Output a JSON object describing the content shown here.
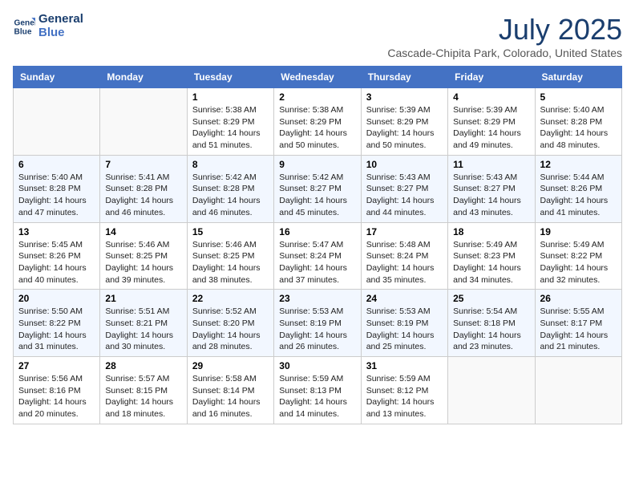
{
  "logo": {
    "line1": "General",
    "line2": "Blue"
  },
  "title": "July 2025",
  "location": "Cascade-Chipita Park, Colorado, United States",
  "days_of_week": [
    "Sunday",
    "Monday",
    "Tuesday",
    "Wednesday",
    "Thursday",
    "Friday",
    "Saturday"
  ],
  "weeks": [
    [
      {
        "day": "",
        "info": ""
      },
      {
        "day": "",
        "info": ""
      },
      {
        "day": "1",
        "info": "Sunrise: 5:38 AM\nSunset: 8:29 PM\nDaylight: 14 hours and 51 minutes."
      },
      {
        "day": "2",
        "info": "Sunrise: 5:38 AM\nSunset: 8:29 PM\nDaylight: 14 hours and 50 minutes."
      },
      {
        "day": "3",
        "info": "Sunrise: 5:39 AM\nSunset: 8:29 PM\nDaylight: 14 hours and 50 minutes."
      },
      {
        "day": "4",
        "info": "Sunrise: 5:39 AM\nSunset: 8:29 PM\nDaylight: 14 hours and 49 minutes."
      },
      {
        "day": "5",
        "info": "Sunrise: 5:40 AM\nSunset: 8:28 PM\nDaylight: 14 hours and 48 minutes."
      }
    ],
    [
      {
        "day": "6",
        "info": "Sunrise: 5:40 AM\nSunset: 8:28 PM\nDaylight: 14 hours and 47 minutes."
      },
      {
        "day": "7",
        "info": "Sunrise: 5:41 AM\nSunset: 8:28 PM\nDaylight: 14 hours and 46 minutes."
      },
      {
        "day": "8",
        "info": "Sunrise: 5:42 AM\nSunset: 8:28 PM\nDaylight: 14 hours and 46 minutes."
      },
      {
        "day": "9",
        "info": "Sunrise: 5:42 AM\nSunset: 8:27 PM\nDaylight: 14 hours and 45 minutes."
      },
      {
        "day": "10",
        "info": "Sunrise: 5:43 AM\nSunset: 8:27 PM\nDaylight: 14 hours and 44 minutes."
      },
      {
        "day": "11",
        "info": "Sunrise: 5:43 AM\nSunset: 8:27 PM\nDaylight: 14 hours and 43 minutes."
      },
      {
        "day": "12",
        "info": "Sunrise: 5:44 AM\nSunset: 8:26 PM\nDaylight: 14 hours and 41 minutes."
      }
    ],
    [
      {
        "day": "13",
        "info": "Sunrise: 5:45 AM\nSunset: 8:26 PM\nDaylight: 14 hours and 40 minutes."
      },
      {
        "day": "14",
        "info": "Sunrise: 5:46 AM\nSunset: 8:25 PM\nDaylight: 14 hours and 39 minutes."
      },
      {
        "day": "15",
        "info": "Sunrise: 5:46 AM\nSunset: 8:25 PM\nDaylight: 14 hours and 38 minutes."
      },
      {
        "day": "16",
        "info": "Sunrise: 5:47 AM\nSunset: 8:24 PM\nDaylight: 14 hours and 37 minutes."
      },
      {
        "day": "17",
        "info": "Sunrise: 5:48 AM\nSunset: 8:24 PM\nDaylight: 14 hours and 35 minutes."
      },
      {
        "day": "18",
        "info": "Sunrise: 5:49 AM\nSunset: 8:23 PM\nDaylight: 14 hours and 34 minutes."
      },
      {
        "day": "19",
        "info": "Sunrise: 5:49 AM\nSunset: 8:22 PM\nDaylight: 14 hours and 32 minutes."
      }
    ],
    [
      {
        "day": "20",
        "info": "Sunrise: 5:50 AM\nSunset: 8:22 PM\nDaylight: 14 hours and 31 minutes."
      },
      {
        "day": "21",
        "info": "Sunrise: 5:51 AM\nSunset: 8:21 PM\nDaylight: 14 hours and 30 minutes."
      },
      {
        "day": "22",
        "info": "Sunrise: 5:52 AM\nSunset: 8:20 PM\nDaylight: 14 hours and 28 minutes."
      },
      {
        "day": "23",
        "info": "Sunrise: 5:53 AM\nSunset: 8:19 PM\nDaylight: 14 hours and 26 minutes."
      },
      {
        "day": "24",
        "info": "Sunrise: 5:53 AM\nSunset: 8:19 PM\nDaylight: 14 hours and 25 minutes."
      },
      {
        "day": "25",
        "info": "Sunrise: 5:54 AM\nSunset: 8:18 PM\nDaylight: 14 hours and 23 minutes."
      },
      {
        "day": "26",
        "info": "Sunrise: 5:55 AM\nSunset: 8:17 PM\nDaylight: 14 hours and 21 minutes."
      }
    ],
    [
      {
        "day": "27",
        "info": "Sunrise: 5:56 AM\nSunset: 8:16 PM\nDaylight: 14 hours and 20 minutes."
      },
      {
        "day": "28",
        "info": "Sunrise: 5:57 AM\nSunset: 8:15 PM\nDaylight: 14 hours and 18 minutes."
      },
      {
        "day": "29",
        "info": "Sunrise: 5:58 AM\nSunset: 8:14 PM\nDaylight: 14 hours and 16 minutes."
      },
      {
        "day": "30",
        "info": "Sunrise: 5:59 AM\nSunset: 8:13 PM\nDaylight: 14 hours and 14 minutes."
      },
      {
        "day": "31",
        "info": "Sunrise: 5:59 AM\nSunset: 8:12 PM\nDaylight: 14 hours and 13 minutes."
      },
      {
        "day": "",
        "info": ""
      },
      {
        "day": "",
        "info": ""
      }
    ]
  ]
}
